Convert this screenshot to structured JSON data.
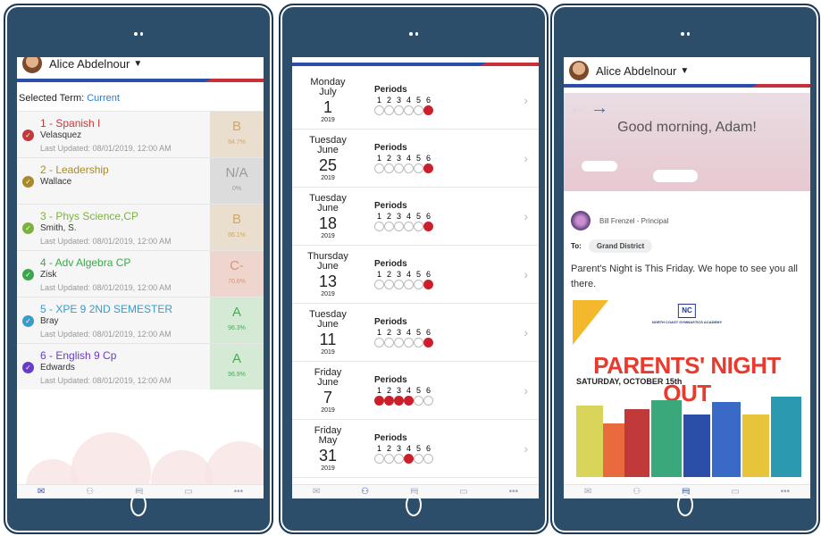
{
  "user": {
    "name": "Alice Abdelnour"
  },
  "grades": {
    "term_label": "Selected Term:",
    "term_value": "Current",
    "courses": [
      {
        "name": "1 - Spanish I",
        "teacher": "Velasquez",
        "updated": "Last Updated: 08/01/2019, 12:00 AM",
        "grade": "B",
        "pct": "84.7%",
        "color": "#c03a3a",
        "bg": "#eadfcf",
        "gcolor": "#cfa76a"
      },
      {
        "name": "2 - Leadership",
        "teacher": "Wallace",
        "updated": "",
        "grade": "N/A",
        "pct": "0%",
        "color": "#a88a2a",
        "bg": "#dcdcdc",
        "gcolor": "#9a9a9a"
      },
      {
        "name": "3 - Phys Science,CP",
        "teacher": "Smith, S.",
        "updated": "Last Updated: 08/01/2019, 12:00 AM",
        "grade": "B",
        "pct": "86.1%",
        "color": "#7bb33a",
        "bg": "#eadfcf",
        "gcolor": "#cfa76a"
      },
      {
        "name": "4 - Adv Algebra CP",
        "teacher": "Zisk",
        "updated": "Last Updated: 08/01/2019, 12:00 AM",
        "grade": "C-",
        "pct": "70.6%",
        "color": "#3aa84a",
        "bg": "#eed6cf",
        "gcolor": "#d4967a"
      },
      {
        "name": "5 - XPE 9 2ND SEMESTER",
        "teacher": "Bray",
        "updated": "Last Updated: 08/01/2019, 12:00 AM",
        "grade": "A",
        "pct": "96.3%",
        "color": "#3a9ac8",
        "bg": "#d4ead4",
        "gcolor": "#4aa85a"
      },
      {
        "name": "6 - English 9 Cp",
        "teacher": "Edwards",
        "updated": "Last Updated: 08/01/2019, 12:00 AM",
        "grade": "A",
        "pct": "96.9%",
        "color": "#6a3ac8",
        "bg": "#d4ead4",
        "gcolor": "#4aa85a"
      }
    ]
  },
  "attendance": {
    "periods_label": "Periods",
    "period_numbers": [
      "1",
      "2",
      "3",
      "4",
      "5",
      "6"
    ],
    "days": [
      {
        "weekday": "Monday",
        "month": "July",
        "day": "1",
        "year": "2019",
        "absent": [
          6
        ]
      },
      {
        "weekday": "Tuesday",
        "month": "June",
        "day": "25",
        "year": "2019",
        "absent": [
          6
        ]
      },
      {
        "weekday": "Tuesday",
        "month": "June",
        "day": "18",
        "year": "2019",
        "absent": [
          6
        ]
      },
      {
        "weekday": "Thursday",
        "month": "June",
        "day": "13",
        "year": "2019",
        "absent": [
          6
        ]
      },
      {
        "weekday": "Tuesday",
        "month": "June",
        "day": "11",
        "year": "2019",
        "absent": [
          6
        ]
      },
      {
        "weekday": "Friday",
        "month": "June",
        "day": "7",
        "year": "2019",
        "absent": [
          1,
          2,
          3,
          4
        ]
      },
      {
        "weekday": "Friday",
        "month": "May",
        "day": "31",
        "year": "2019",
        "absent": [
          4
        ]
      }
    ]
  },
  "feed": {
    "greeting": "Good morning, Adam!",
    "author": "Bill Frenzel - Principal",
    "to_label": "To:",
    "to_value": "Grand District",
    "message": "Parent's Night is This Friday. We hope to see you all there.",
    "flyer_org": "NORTH COAST GYMNASTICS ACADEMY",
    "flyer_title": "PARENTS' NIGHT OUT",
    "flyer_date": "SATURDAY, OCTOBER 15th"
  },
  "tabbar": {
    "more": "•••"
  }
}
